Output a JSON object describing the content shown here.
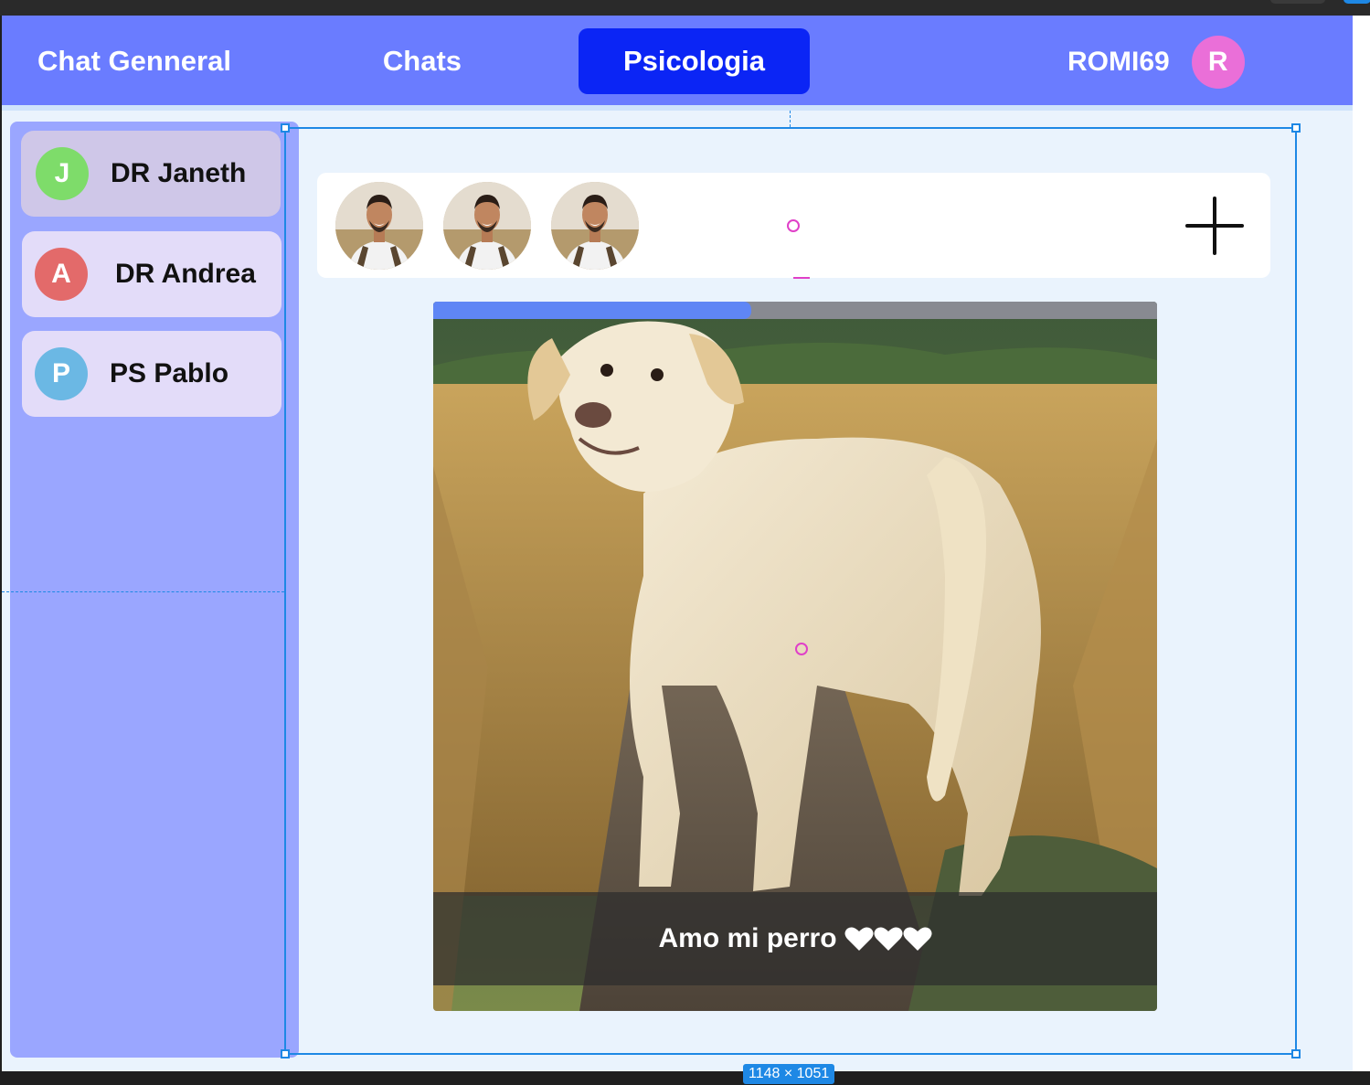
{
  "navbar": {
    "general_label": "Chat Genneral",
    "chats_label": "Chats",
    "active_label": "Psicologia",
    "username": "ROMI69",
    "user_initial": "R"
  },
  "sidebar": {
    "contacts": [
      {
        "initial": "J",
        "name": "DR Janeth",
        "color": "#7edc6a",
        "selected": true
      },
      {
        "initial": "A",
        "name": "DR Andrea",
        "color": "#e36a6a",
        "selected": false
      },
      {
        "initial": "P",
        "name": "PS Pablo",
        "color": "#6bb8e4",
        "selected": false
      }
    ]
  },
  "stories": {
    "count": 3,
    "avatar_icon": "person-photo-icon",
    "add_icon": "plus-icon"
  },
  "post": {
    "caption": "Amo mi perro",
    "heart_icon": "heart-icon",
    "hearts": 3,
    "progress_fraction": 0.44,
    "image": "dog-photo"
  },
  "editor": {
    "dimensions": "1148 × 1051"
  },
  "colors": {
    "navbar": "#6a7cff",
    "active_tab": "#0b25f5",
    "sidebar": "#9aa6ff",
    "selection": "#1e88e5"
  }
}
